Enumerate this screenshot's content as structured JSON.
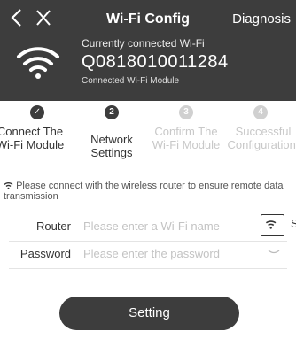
{
  "header": {
    "title": "Wi-Fi Config",
    "diagnosis_label": "Diagnosis",
    "background": "#3d3d3d",
    "connected_label": "Currently connected Wi-Fi",
    "ssid": "Q0818010011284",
    "module_label": "Connected Wi-Fi Module"
  },
  "steps": [
    {
      "number": "✓",
      "label": "Connect The Wi-Fi Module",
      "state": "done"
    },
    {
      "number": "2",
      "label": "Network Settings",
      "state": "current"
    },
    {
      "number": "3",
      "label": "Confirm The Wi-Fi Module",
      "state": "pending"
    },
    {
      "number": "4",
      "label": "Successful Configuration.",
      "state": "pending"
    }
  ],
  "colors": {
    "accent": "#3d3d3d",
    "pending": "#d0d0d0",
    "pending_text": "#c8c8c8"
  },
  "hint": "Please connect with the wireless router to ensure remote data transmission",
  "router": {
    "label": "Router",
    "placeholder": "Please enter a Wi-Fi name",
    "value": ""
  },
  "password": {
    "label": "Password",
    "placeholder": "Please enter the password",
    "value": ""
  },
  "edge_mark": "S",
  "setting_label": "Setting"
}
